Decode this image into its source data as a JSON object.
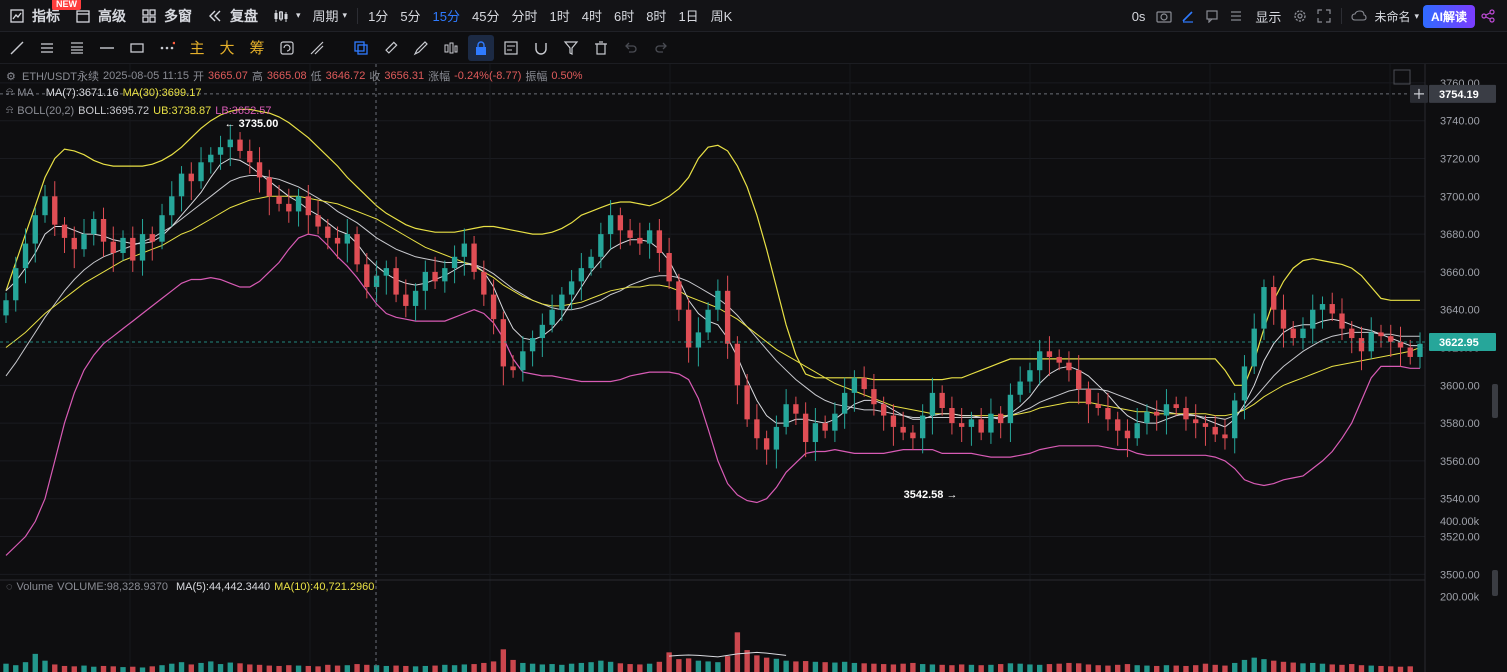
{
  "toolbar": {
    "indicators": "指标",
    "new_badge": "NEW",
    "advanced": "高级",
    "multi_window": "多窗",
    "replay": "复盘",
    "period": "周期",
    "intervals": [
      "1分",
      "5分",
      "15分",
      "45分",
      "分时",
      "1时",
      "4时",
      "6时",
      "8时",
      "1日",
      "周K"
    ],
    "active_interval": "15分",
    "countdown": "0s",
    "display": "显示",
    "unnamed": "未命名",
    "ai": "AI解读"
  },
  "drawing_tools": {
    "text_tools": [
      "主",
      "大",
      "筹"
    ]
  },
  "legend": {
    "symbol": "ETH/USDT永续",
    "datetime": "2025-08-05 11:15",
    "open_label": "开",
    "open": "3665.07",
    "high_label": "高",
    "high": "3665.08",
    "low_label": "低",
    "low": "3646.72",
    "close_label": "收",
    "close": "3656.31",
    "change_label": "涨幅",
    "change": "-0.24%(-8.77)",
    "amp_label": "振幅",
    "amp": "0.50%",
    "ma_name": "MA",
    "ma7": "MA(7):3671.16",
    "ma30": "MA(30):3699.17",
    "boll_name": "BOLL(20,2)",
    "boll_mid": "BOLL:3695.72",
    "boll_ub": "UB:3738.87",
    "boll_lb": "LB:3652.57",
    "vol_name": "Volume",
    "vol": "VOLUME:98,328.9370",
    "vol_ma5": "MA(5):44,442.3440",
    "vol_ma10": "MA(10):40,721.2960"
  },
  "colors": {
    "up": "#26a69a",
    "down": "#e04e55",
    "ma7": "#d9dadf",
    "ma30": "#e8e045",
    "boll_mid": "#c8c9ce",
    "boll_ub": "#e8e045",
    "boll_lb": "#d85bb5"
  },
  "price_axis": {
    "ticks": [
      "3760.00",
      "3740.00",
      "3720.00",
      "3700.00",
      "3680.00",
      "3660.00",
      "3640.00",
      "3620.00",
      "3600.00",
      "3580.00",
      "3560.00",
      "3540.00",
      "3520.00",
      "3500.00"
    ],
    "crosshair_price": "3754.19",
    "last_price": "3622.95"
  },
  "volume_axis": {
    "ticks": [
      "400.00k",
      "200.00k"
    ]
  },
  "annotations": {
    "high_mark": "3735.00",
    "low_mark": "3542.58"
  },
  "chart_data": {
    "type": "candlestick",
    "symbol": "ETH/USDT永续",
    "interval": "15分",
    "ylim": [
      3497,
      3770
    ],
    "high_marker": 3735.0,
    "low_marker": 3542.58,
    "last_price": 3622.95,
    "series_meta": [
      "close",
      "MA(7)",
      "MA(30)",
      "BOLL",
      "UB",
      "LB",
      "VOLUME"
    ],
    "close": [
      3645,
      3662,
      3675,
      3690,
      3700,
      3685,
      3678,
      3672,
      3680,
      3688,
      3676,
      3670,
      3678,
      3666,
      3680,
      3676,
      3690,
      3700,
      3712,
      3708,
      3718,
      3722,
      3726,
      3730,
      3724,
      3718,
      3710,
      3700,
      3696,
      3692,
      3700,
      3690,
      3684,
      3678,
      3675,
      3680,
      3664,
      3652,
      3658,
      3662,
      3648,
      3642,
      3650,
      3660,
      3655,
      3662,
      3668,
      3675,
      3660,
      3648,
      3635,
      3610,
      3608,
      3618,
      3625,
      3632,
      3640,
      3648,
      3655,
      3662,
      3668,
      3680,
      3690,
      3682,
      3678,
      3675,
      3682,
      3670,
      3655,
      3640,
      3620,
      3628,
      3640,
      3650,
      3622,
      3600,
      3582,
      3572,
      3566,
      3578,
      3590,
      3585,
      3570,
      3580,
      3576,
      3585,
      3596,
      3604,
      3598,
      3590,
      3584,
      3578,
      3575,
      3572,
      3584,
      3596,
      3588,
      3580,
      3578,
      3582,
      3575,
      3585,
      3580,
      3595,
      3602,
      3608,
      3618,
      3615,
      3612,
      3608,
      3598,
      3590,
      3588,
      3582,
      3576,
      3572,
      3580,
      3586,
      3584,
      3590,
      3588,
      3582,
      3580,
      3578,
      3574,
      3572,
      3592,
      3610,
      3630,
      3652,
      3640,
      3630,
      3625,
      3630,
      3640,
      3643,
      3638,
      3630,
      3625,
      3618,
      3628,
      3626,
      3623,
      3620,
      3615,
      3622
    ],
    "ma7": [
      3650,
      3655,
      3662,
      3670,
      3680,
      3684,
      3684,
      3682,
      3680,
      3680,
      3679,
      3677,
      3676,
      3675,
      3675,
      3676,
      3679,
      3684,
      3690,
      3696,
      3702,
      3710,
      3717,
      3720,
      3719,
      3716,
      3712,
      3708,
      3704,
      3700,
      3697,
      3693,
      3690,
      3686,
      3682,
      3680,
      3675,
      3668,
      3663,
      3659,
      3656,
      3654,
      3653,
      3654,
      3656,
      3658,
      3661,
      3664,
      3664,
      3660,
      3652,
      3640,
      3630,
      3625,
      3624,
      3626,
      3630,
      3636,
      3644,
      3652,
      3660,
      3666,
      3672,
      3675,
      3677,
      3677,
      3676,
      3672,
      3666,
      3656,
      3645,
      3638,
      3634,
      3632,
      3625,
      3615,
      3603,
      3592,
      3584,
      3580,
      3580,
      3582,
      3582,
      3581,
      3580,
      3582,
      3586,
      3590,
      3592,
      3592,
      3590,
      3587,
      3584,
      3582,
      3582,
      3584,
      3585,
      3585,
      3584,
      3584,
      3583,
      3583,
      3582,
      3585,
      3589,
      3594,
      3601,
      3606,
      3609,
      3610,
      3608,
      3605,
      3600,
      3595,
      3589,
      3584,
      3581,
      3580,
      3580,
      3582,
      3584,
      3585,
      3584,
      3582,
      3580,
      3578,
      3582,
      3590,
      3600,
      3613,
      3622,
      3628,
      3631,
      3632,
      3632,
      3634,
      3635,
      3634,
      3632,
      3630,
      3629,
      3627,
      3625,
      3623,
      3621,
      3621
    ],
    "ma30": [
      3620,
      3624,
      3628,
      3633,
      3638,
      3642,
      3646,
      3650,
      3654,
      3657,
      3660,
      3663,
      3666,
      3668,
      3670,
      3672,
      3674,
      3677,
      3680,
      3682,
      3685,
      3688,
      3691,
      3694,
      3696,
      3698,
      3699,
      3700,
      3700,
      3700,
      3700,
      3699,
      3698,
      3697,
      3696,
      3694,
      3692,
      3690,
      3688,
      3685,
      3682,
      3679,
      3676,
      3673,
      3671,
      3669,
      3667,
      3665,
      3663,
      3660,
      3657,
      3653,
      3650,
      3647,
      3645,
      3643,
      3642,
      3642,
      3643,
      3644,
      3646,
      3648,
      3650,
      3651,
      3652,
      3652,
      3653,
      3653,
      3652,
      3650,
      3647,
      3645,
      3643,
      3641,
      3638,
      3635,
      3631,
      3627,
      3623,
      3619,
      3616,
      3613,
      3610,
      3607,
      3604,
      3601,
      3599,
      3597,
      3595,
      3593,
      3591,
      3589,
      3588,
      3587,
      3586,
      3585,
      3585,
      3585,
      3584,
      3584,
      3584,
      3584,
      3584,
      3584,
      3585,
      3586,
      3588,
      3589,
      3590,
      3591,
      3591,
      3591,
      3590,
      3589,
      3588,
      3587,
      3586,
      3586,
      3585,
      3585,
      3585,
      3585,
      3585,
      3585,
      3584,
      3584,
      3585,
      3587,
      3590,
      3594,
      3597,
      3600,
      3602,
      3604,
      3606,
      3608,
      3610,
      3611,
      3612,
      3613,
      3614,
      3615,
      3616,
      3617,
      3618,
      3620
    ],
    "boll_mid": [
      3605,
      3612,
      3620,
      3628,
      3636,
      3643,
      3650,
      3656,
      3661,
      3665,
      3668,
      3670,
      3672,
      3674,
      3676,
      3678,
      3681,
      3684,
      3688,
      3692,
      3696,
      3700,
      3704,
      3708,
      3710,
      3711,
      3711,
      3710,
      3709,
      3707,
      3705,
      3702,
      3699,
      3696,
      3692,
      3689,
      3686,
      3682,
      3678,
      3675,
      3672,
      3670,
      3668,
      3667,
      3666,
      3665,
      3665,
      3665,
      3664,
      3662,
      3659,
      3655,
      3651,
      3648,
      3645,
      3643,
      3641,
      3640,
      3640,
      3641,
      3643,
      3645,
      3648,
      3650,
      3653,
      3655,
      3657,
      3658,
      3658,
      3657,
      3655,
      3652,
      3649,
      3646,
      3642,
      3637,
      3631,
      3625,
      3619,
      3613,
      3608,
      3603,
      3599,
      3595,
      3592,
      3590,
      3589,
      3588,
      3587,
      3587,
      3586,
      3585,
      3584,
      3583,
      3583,
      3583,
      3583,
      3583,
      3583,
      3583,
      3583,
      3583,
      3583,
      3584,
      3586,
      3588,
      3591,
      3593,
      3595,
      3597,
      3598,
      3598,
      3598,
      3597,
      3595,
      3593,
      3591,
      3589,
      3587,
      3586,
      3585,
      3584,
      3584,
      3583,
      3583,
      3582,
      3584,
      3588,
      3593,
      3599,
      3605,
      3610,
      3614,
      3618,
      3621,
      3624,
      3626,
      3627,
      3628,
      3628,
      3628,
      3627,
      3627,
      3626,
      3626,
      3626
    ],
    "boll_ub": [
      3650,
      3665,
      3680,
      3695,
      3710,
      3720,
      3725,
      3724,
      3722,
      3719,
      3717,
      3716,
      3716,
      3716,
      3716,
      3717,
      3719,
      3722,
      3726,
      3731,
      3736,
      3740,
      3743,
      3745,
      3746,
      3746,
      3745,
      3744,
      3742,
      3739,
      3735,
      3731,
      3726,
      3721,
      3716,
      3710,
      3705,
      3700,
      3695,
      3691,
      3688,
      3685,
      3683,
      3682,
      3681,
      3681,
      3681,
      3682,
      3683,
      3684,
      3684,
      3683,
      3682,
      3681,
      3680,
      3680,
      3681,
      3683,
      3686,
      3690,
      3692,
      3694,
      3696,
      3697,
      3697,
      3696,
      3695,
      3697,
      3700,
      3704,
      3710,
      3720,
      3726,
      3727,
      3724,
      3716,
      3705,
      3690,
      3672,
      3652,
      3632,
      3616,
      3606,
      3604,
      3604,
      3604,
      3604,
      3604,
      3604,
      3603,
      3603,
      3603,
      3603,
      3603,
      3603,
      3603,
      3603,
      3604,
      3604,
      3606,
      3608,
      3610,
      3612,
      3614,
      3614,
      3614,
      3614,
      3614,
      3614,
      3614,
      3614,
      3614,
      3614,
      3614,
      3614,
      3614,
      3614,
      3614,
      3614,
      3614,
      3614,
      3614,
      3614,
      3614,
      3614,
      3608,
      3600,
      3600,
      3613,
      3630,
      3645,
      3655,
      3662,
      3666,
      3667,
      3666,
      3665,
      3664,
      3662,
      3658,
      3652,
      3646,
      3645,
      3645,
      3645,
      3645
    ],
    "boll_lb": [
      3510,
      3515,
      3520,
      3528,
      3540,
      3560,
      3580,
      3596,
      3608,
      3616,
      3622,
      3626,
      3630,
      3634,
      3638,
      3642,
      3646,
      3650,
      3654,
      3656,
      3656,
      3657,
      3656,
      3654,
      3652,
      3652,
      3655,
      3660,
      3665,
      3672,
      3678,
      3680,
      3679,
      3674,
      3668,
      3663,
      3657,
      3650,
      3643,
      3638,
      3636,
      3635,
      3634,
      3634,
      3634,
      3634,
      3636,
      3638,
      3640,
      3638,
      3633,
      3625,
      3614,
      3607,
      3606,
      3605,
      3605,
      3604,
      3603,
      3602,
      3602,
      3602,
      3602,
      3603,
      3605,
      3606,
      3607,
      3607,
      3607,
      3606,
      3603,
      3593,
      3577,
      3560,
      3548,
      3542,
      3539,
      3538,
      3540,
      3546,
      3554,
      3559,
      3564,
      3565,
      3565,
      3566,
      3565,
      3564,
      3564,
      3564,
      3564,
      3565,
      3566,
      3566,
      3566,
      3566,
      3564,
      3564,
      3564,
      3564,
      3563,
      3562,
      3562,
      3562,
      3563,
      3564,
      3566,
      3567,
      3568,
      3568,
      3568,
      3568,
      3568,
      3567,
      3566,
      3566,
      3564,
      3563,
      3563,
      3563,
      3563,
      3563,
      3563,
      3563,
      3562,
      3560,
      3556,
      3550,
      3548,
      3547,
      3548,
      3550,
      3551,
      3552,
      3556,
      3560,
      3565,
      3572,
      3580,
      3592,
      3604,
      3610,
      3610,
      3610,
      3609,
      3609
    ],
    "volume": [
      22000,
      18000,
      26000,
      48000,
      30000,
      20000,
      16000,
      15000,
      17000,
      14000,
      16000,
      15000,
      13000,
      14000,
      12000,
      15000,
      18000,
      22000,
      26000,
      20000,
      24000,
      28000,
      21000,
      25000,
      23000,
      20000,
      19000,
      17000,
      16000,
      18000,
      17000,
      16000,
      15000,
      19000,
      17000,
      18000,
      21000,
      19000,
      18000,
      16000,
      17000,
      16000,
      15000,
      16000,
      17000,
      19000,
      18000,
      20000,
      21000,
      24000,
      28000,
      60000,
      32000,
      24000,
      22000,
      20000,
      21000,
      19000,
      22000,
      24000,
      26000,
      30000,
      27000,
      23000,
      21000,
      20000,
      22000,
      27000,
      52000,
      34000,
      36000,
      30000,
      28000,
      26000,
      42000,
      105000,
      58000,
      44000,
      38000,
      35000,
      30000,
      28000,
      29000,
      27000,
      26000,
      25000,
      27000,
      24000,
      23000,
      22000,
      21000,
      20000,
      22000,
      24000,
      21000,
      20000,
      19000,
      18000,
      20000,
      19000,
      18000,
      19000,
      21000,
      23000,
      22000,
      20000,
      19000,
      21000,
      22000,
      24000,
      23000,
      20000,
      18000,
      17000,
      19000,
      21000,
      18000,
      17000,
      16000,
      18000,
      17000,
      16000,
      18000,
      22000,
      19000,
      17000,
      24000,
      32000,
      38000,
      34000,
      30000,
      27000,
      25000,
      23000,
      24000,
      22000,
      20000,
      19000,
      21000,
      18000,
      17000,
      16000,
      15000,
      14000,
      15000
    ],
    "volume_ma5": [
      null,
      null,
      null,
      null,
      null,
      null,
      null,
      null,
      null,
      null,
      null,
      null,
      null,
      null,
      null,
      null,
      null,
      null,
      null,
      null,
      null,
      null,
      null,
      null,
      null,
      null,
      null,
      null,
      null,
      null,
      null,
      null,
      null,
      null,
      null,
      null,
      null,
      null,
      null,
      null,
      null,
      null,
      null,
      null,
      null,
      null,
      null,
      null,
      null,
      null,
      null,
      null,
      null,
      null,
      null,
      null,
      null,
      null,
      null,
      null,
      null,
      null,
      null,
      null,
      null,
      null,
      null,
      null,
      42000,
      44000,
      45000,
      44000,
      42000,
      40000,
      44000,
      48000,
      50000,
      52000,
      50000,
      47000,
      44000
    ]
  }
}
